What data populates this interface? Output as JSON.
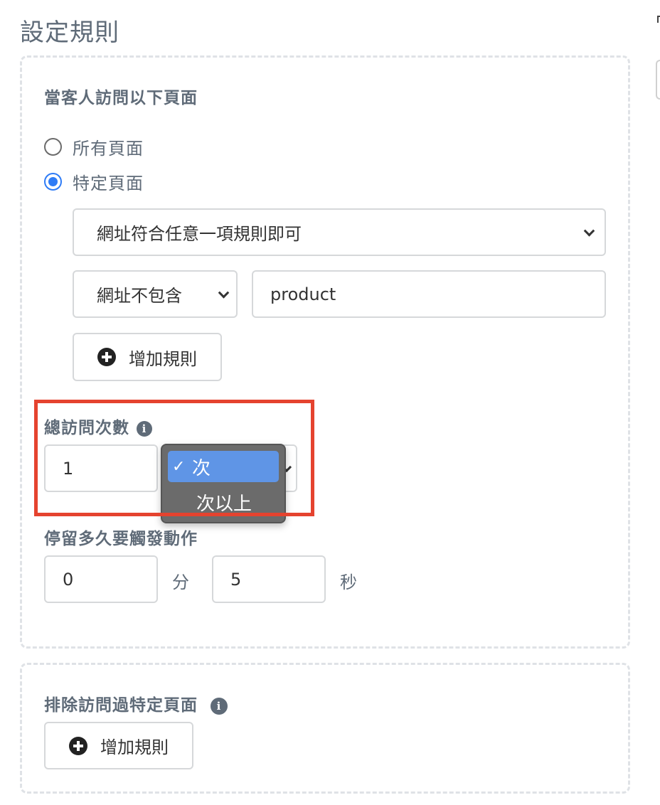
{
  "page_title": "設定規則",
  "visit_section": {
    "label": "當客人訪問以下頁面",
    "options": [
      {
        "label": "所有頁面",
        "checked": false
      },
      {
        "label": "特定頁面",
        "checked": true
      }
    ],
    "match_select": "網址符合任意一項規則即可",
    "condition_select": "網址不包含",
    "condition_value": "product",
    "add_rule_label": "增加規則"
  },
  "visit_count": {
    "label": "總訪問次數",
    "value": "1",
    "unit_options": [
      {
        "label": "次",
        "selected": true
      },
      {
        "label": "次以上",
        "selected": false
      }
    ],
    "check_mark": "✓"
  },
  "stay_time": {
    "label": "停留多久要觸發動作",
    "minutes_value": "0",
    "minutes_unit": "分",
    "seconds_value": "5",
    "seconds_unit": "秒"
  },
  "exclude_section": {
    "label": "排除訪問過特定頁面",
    "add_rule_label": "增加規則"
  },
  "info_glyph": "i",
  "colors": {
    "accent": "#2f7cf6",
    "highlight": "#e5432f",
    "dropdown_bg": "#6b6b6b",
    "dropdown_selected": "#5f95e6",
    "label_text": "#5f6b78"
  }
}
